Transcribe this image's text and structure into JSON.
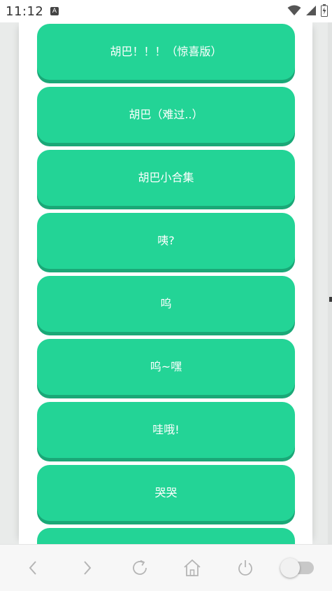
{
  "status_bar": {
    "time": "11:12",
    "a_icon_label": "A",
    "icons": [
      "wifi-icon",
      "signal-icon",
      "battery-icon"
    ]
  },
  "sounds": [
    {
      "label": "胡巴！！！（惊喜版）"
    },
    {
      "label": "胡巴（难过..）"
    },
    {
      "label": "胡巴小合集"
    },
    {
      "label": "咦?"
    },
    {
      "label": "呜"
    },
    {
      "label": "呜~嘿"
    },
    {
      "label": "哇哦!"
    },
    {
      "label": "哭哭"
    },
    {
      "label": ""
    }
  ],
  "nav_bar": {
    "icons": [
      "back-icon",
      "forward-icon",
      "refresh-icon",
      "home-icon",
      "power-icon",
      "toggle-switch"
    ]
  },
  "colors": {
    "button": "#23d496",
    "button_shadow": "#1aa877",
    "button_text": "#ffffff",
    "nav_icon": "#b5b5b5"
  }
}
